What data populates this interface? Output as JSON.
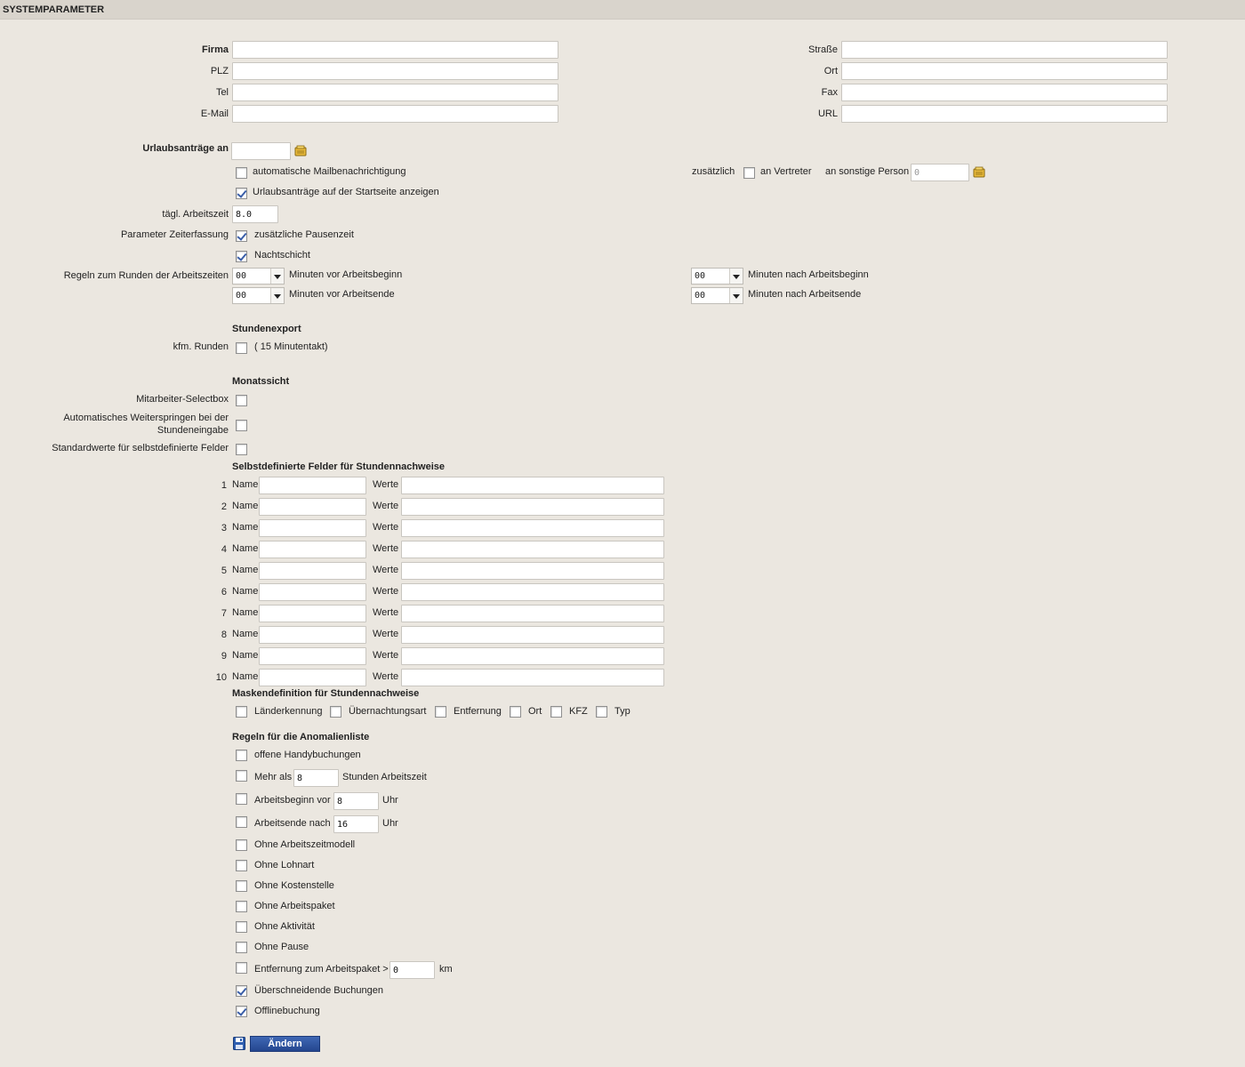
{
  "title": "SYSTEMPARAMETER",
  "company": {
    "firma_label": "Firma",
    "firma_value": "",
    "plz_label": "PLZ",
    "plz_value": "",
    "tel_label": "Tel",
    "tel_value": "",
    "email_label": "E-Mail",
    "email_value": "",
    "strasse_label": "Straße",
    "strasse_value": "",
    "ort_label": "Ort",
    "ort_value": "",
    "fax_label": "Fax",
    "fax_value": "",
    "url_label": "URL",
    "url_value": ""
  },
  "vacation": {
    "label": "Urlaubsanträge an",
    "value": "",
    "auto_mail_label": "automatische Mailbenachrichtigung",
    "auto_mail_checked": false,
    "show_start_label": "Urlaubsanträge auf der Startseite anzeigen",
    "show_start_checked": true,
    "additional_label": "zusätzlich",
    "substitute_label": "an Vertreter",
    "substitute_checked": false,
    "other_person_label": "an sonstige Person",
    "other_person_value": "0"
  },
  "worktime": {
    "daily_label": "tägl. Arbeitszeit",
    "daily_value": "8.0",
    "params_label": "Parameter Zeiterfassung",
    "extra_break_label": "zusätzliche Pausenzeit",
    "extra_break_checked": true,
    "night_shift_label": "Nachtschicht",
    "night_shift_checked": true
  },
  "rounding": {
    "label": "Regeln zum Runden der Arbeitszeiten",
    "before_start_value": "00",
    "before_start_label": "Minuten vor Arbeitsbeginn",
    "before_end_value": "00",
    "before_end_label": "Minuten vor Arbeitsende",
    "after_start_value": "00",
    "after_start_label": "Minuten nach Arbeitsbeginn",
    "after_end_value": "00",
    "after_end_label": "Minuten nach Arbeitsende"
  },
  "export": {
    "heading": "Stundenexport",
    "kfm_label": "kfm. Runden",
    "kfm_checked": false,
    "kfm_note": "( 15 Minutentakt)"
  },
  "month": {
    "heading": "Monatssicht",
    "selectbox_label": "Mitarbeiter-Selectbox",
    "autojump_label_1": "Automatisches Weiterspringen bei der",
    "autojump_label_2": "Stundeneingabe",
    "defaults_label": "Standardwerte für selbstdefinierte Felder"
  },
  "custom_fields": {
    "heading": "Selbstdefinierte Felder für Stundennachweise",
    "name_label": "Name",
    "values_label": "Werte",
    "rows": [
      {
        "num": "1",
        "name": "",
        "values": ""
      },
      {
        "num": "2",
        "name": "",
        "values": ""
      },
      {
        "num": "3",
        "name": "",
        "values": ""
      },
      {
        "num": "4",
        "name": "",
        "values": ""
      },
      {
        "num": "5",
        "name": "",
        "values": ""
      },
      {
        "num": "6",
        "name": "",
        "values": ""
      },
      {
        "num": "7",
        "name": "",
        "values": ""
      },
      {
        "num": "8",
        "name": "",
        "values": ""
      },
      {
        "num": "9",
        "name": "",
        "values": ""
      },
      {
        "num": "10",
        "name": "",
        "values": ""
      }
    ]
  },
  "mask": {
    "heading": "Maskendefinition für Stundennachweise",
    "items": [
      {
        "label": "Länderkennung",
        "checked": false
      },
      {
        "label": "Übernachtungsart",
        "checked": false
      },
      {
        "label": "Entfernung",
        "checked": false
      },
      {
        "label": "Ort",
        "checked": false
      },
      {
        "label": "KFZ",
        "checked": false
      },
      {
        "label": "Typ",
        "checked": false
      }
    ]
  },
  "anomalies": {
    "heading": "Regeln für die Anomalienliste",
    "open_mobile": "offene Handybuchungen",
    "more_than": "Mehr als",
    "more_than_value": "8",
    "more_than_suffix": "Stunden Arbeitszeit",
    "start_before": "Arbeitsbeginn vor",
    "start_before_value": "8",
    "end_after": "Arbeitsende nach",
    "end_after_value": "16",
    "uhr": "Uhr",
    "simple": [
      {
        "label": "Ohne Arbeitszeitmodell",
        "checked": false
      },
      {
        "label": "Ohne Lohnart",
        "checked": false
      },
      {
        "label": "Ohne Kostenstelle",
        "checked": false
      },
      {
        "label": "Ohne Arbeitspaket",
        "checked": false
      },
      {
        "label": "Ohne Aktivität",
        "checked": false
      },
      {
        "label": "Ohne Pause",
        "checked": false
      }
    ],
    "distance": "Entfernung zum Arbeitspaket >",
    "distance_value": "0",
    "distance_unit": "km",
    "overlapping": "Überschneidende Buchungen",
    "overlapping_checked": true,
    "offline": "Offlinebuchung",
    "offline_checked": true
  },
  "save_button": "Ändern",
  "icons": {
    "picker": "address-book-icon",
    "save": "floppy-disk-icon"
  },
  "colors": {
    "background": "#ebe7e0",
    "titlebar": "#d9d4cc",
    "button": "#2f55a0",
    "check": "#3a5ea8"
  }
}
